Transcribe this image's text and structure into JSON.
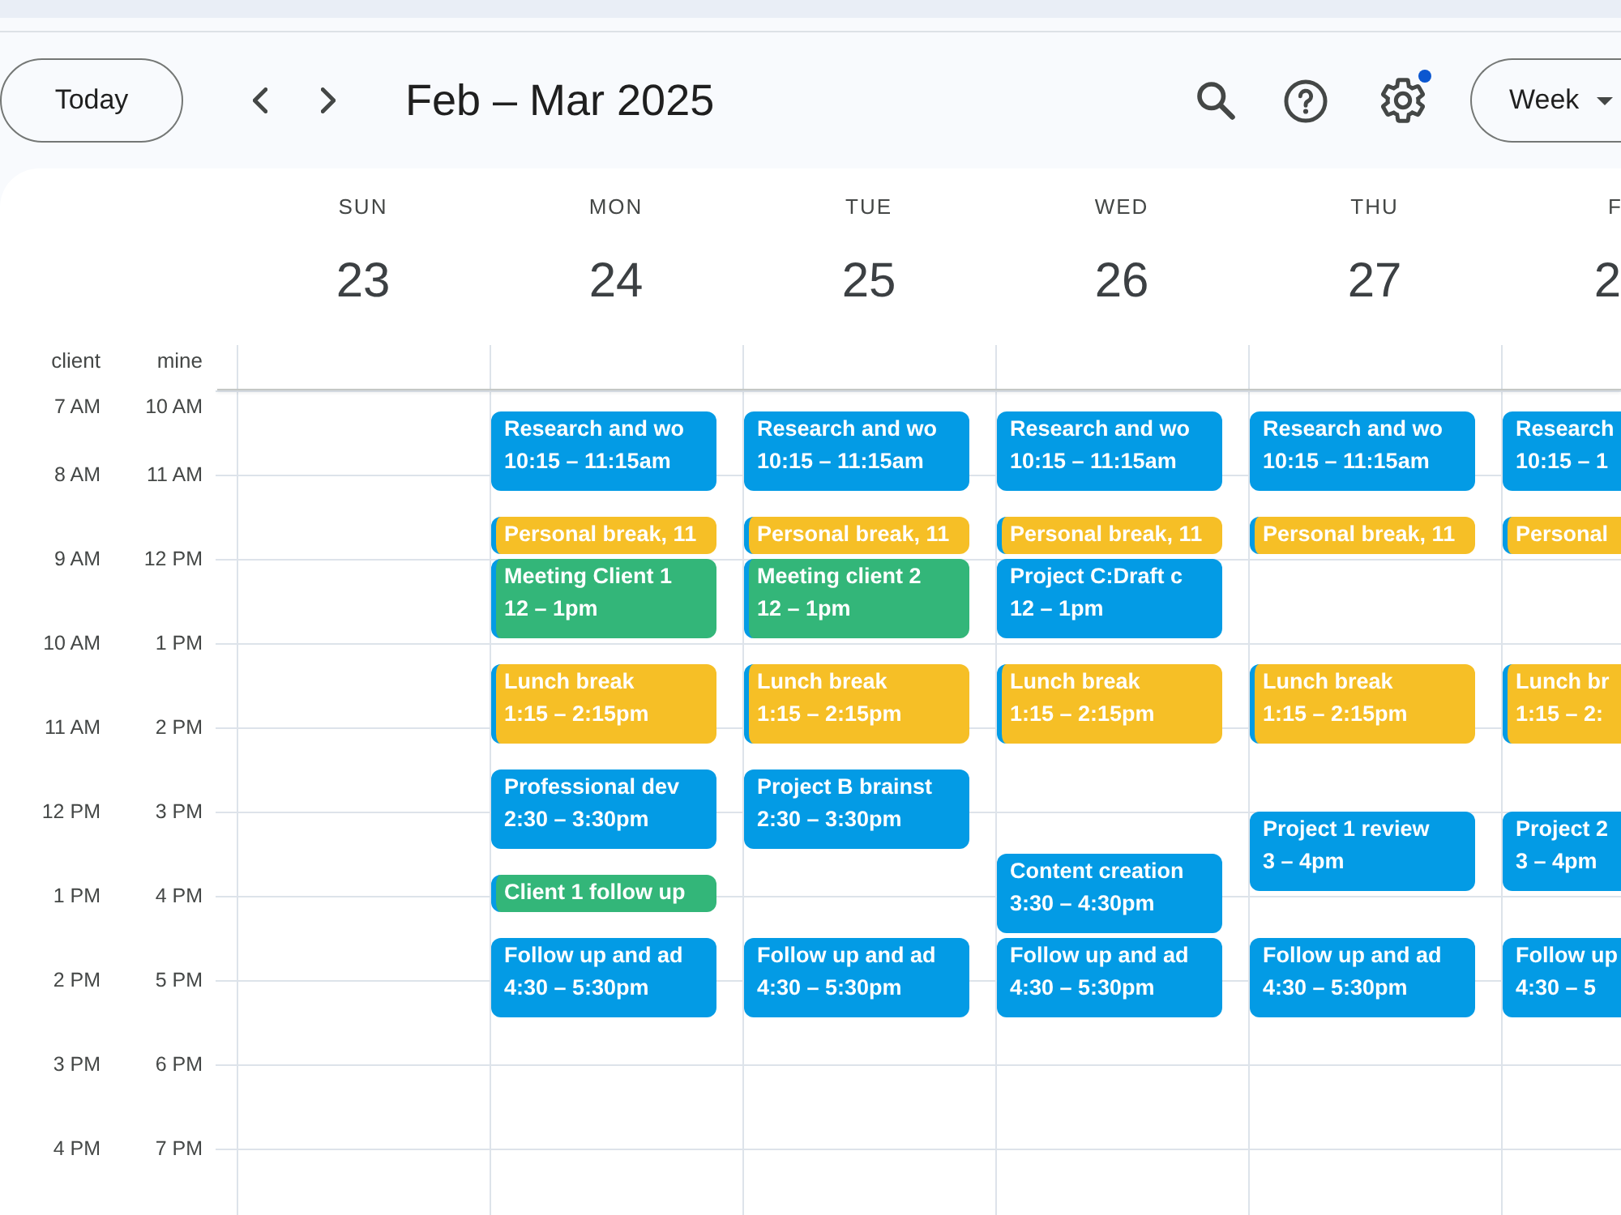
{
  "toolbar": {
    "today": "Today",
    "title": "Feb – Mar 2025",
    "settings_badge": true,
    "view": "Week"
  },
  "week": {
    "timezones": [
      "client",
      "mine"
    ],
    "hour_rows": [
      [
        "7 AM",
        "10 AM"
      ],
      [
        "8 AM",
        "11 AM"
      ],
      [
        "9 AM",
        "12 PM"
      ],
      [
        "10 AM",
        "1 PM"
      ],
      [
        "11 AM",
        "2 PM"
      ],
      [
        "12 PM",
        "3 PM"
      ],
      [
        "1 PM",
        "4 PM"
      ],
      [
        "2 PM",
        "5 PM"
      ],
      [
        "3 PM",
        "6 PM"
      ],
      [
        "4 PM",
        "7 PM"
      ]
    ],
    "days": [
      {
        "name": "SUN",
        "date": "23"
      },
      {
        "name": "MON",
        "date": "24",
        "events": [
          {
            "title": "Research and wo",
            "time": "10:15 – 11:15am",
            "color": "#039be5",
            "stripe": false
          },
          {
            "title": "Personal break, 11",
            "color": "#f6bf26",
            "stripe": true
          },
          {
            "title": "Meeting Client 1",
            "time": "12 – 1pm",
            "color": "#33b679",
            "stripe": true
          },
          {
            "title": "Lunch break",
            "time": "1:15 – 2:15pm",
            "color": "#f6bf26",
            "stripe": true
          },
          {
            "title": "Professional dev",
            "time": "2:30 – 3:30pm",
            "color": "#039be5",
            "stripe": false
          },
          {
            "title": "Client 1 follow up",
            "color": "#33b679",
            "stripe": true
          },
          {
            "title": "Follow up and ad",
            "time": "4:30 – 5:30pm",
            "color": "#039be5",
            "stripe": false
          }
        ]
      },
      {
        "name": "TUE",
        "date": "25",
        "events": [
          {
            "title": "Research and wo",
            "time": "10:15 – 11:15am",
            "color": "#039be5",
            "stripe": false
          },
          {
            "title": "Personal break, 11",
            "color": "#f6bf26",
            "stripe": true
          },
          {
            "title": "Meeting client 2",
            "time": "12 – 1pm",
            "color": "#33b679",
            "stripe": true
          },
          {
            "title": "Lunch break",
            "time": "1:15 – 2:15pm",
            "color": "#f6bf26",
            "stripe": true
          },
          {
            "title": "Project B brainst",
            "time": "2:30 – 3:30pm",
            "color": "#039be5",
            "stripe": false
          },
          {
            "title": "Follow up and ad",
            "time": "4:30 – 5:30pm",
            "color": "#039be5",
            "stripe": false
          }
        ]
      },
      {
        "name": "WED",
        "date": "26",
        "events": [
          {
            "title": "Research and wo",
            "time": "10:15 – 11:15am",
            "color": "#039be5",
            "stripe": false
          },
          {
            "title": "Personal break, 11",
            "color": "#f6bf26",
            "stripe": true
          },
          {
            "title": "Project C:Draft c",
            "time": "12 – 1pm",
            "color": "#039be5",
            "stripe": false
          },
          {
            "title": "Lunch break",
            "time": "1:15 – 2:15pm",
            "color": "#f6bf26",
            "stripe": true
          },
          {
            "title": "Content creation",
            "time": "3:30 – 4:30pm",
            "color": "#039be5",
            "stripe": false
          },
          {
            "title": "Follow up and ad",
            "time": "4:30 – 5:30pm",
            "color": "#039be5",
            "stripe": false
          }
        ]
      },
      {
        "name": "THU",
        "date": "27",
        "events": [
          {
            "title": "Research and wo",
            "time": "10:15 – 11:15am",
            "color": "#039be5",
            "stripe": false
          },
          {
            "title": "Personal break, 11",
            "color": "#f6bf26",
            "stripe": true
          },
          {
            "title": "Lunch break",
            "time": "1:15 – 2:15pm",
            "color": "#f6bf26",
            "stripe": true
          },
          {
            "title": "Project 1 review",
            "time": "3 – 4pm",
            "color": "#039be5",
            "stripe": false
          },
          {
            "title": "Follow up and ad",
            "time": "4:30 – 5:30pm",
            "color": "#039be5",
            "stripe": false
          }
        ]
      },
      {
        "name": "F",
        "date": "2",
        "events": [
          {
            "title": "Research",
            "time": "10:15 – 1",
            "color": "#039be5",
            "stripe": false
          },
          {
            "title": "Personal",
            "color": "#f6bf26",
            "stripe": true
          },
          {
            "title": "Lunch br",
            "time": "1:15 – 2:",
            "color": "#f6bf26",
            "stripe": true
          },
          {
            "title": "Project 2",
            "time": "3 – 4pm",
            "color": "#039be5",
            "stripe": false
          },
          {
            "title": "Follow up",
            "time": "4:30 – 5",
            "color": "#039be5",
            "stripe": false
          }
        ]
      }
    ]
  }
}
